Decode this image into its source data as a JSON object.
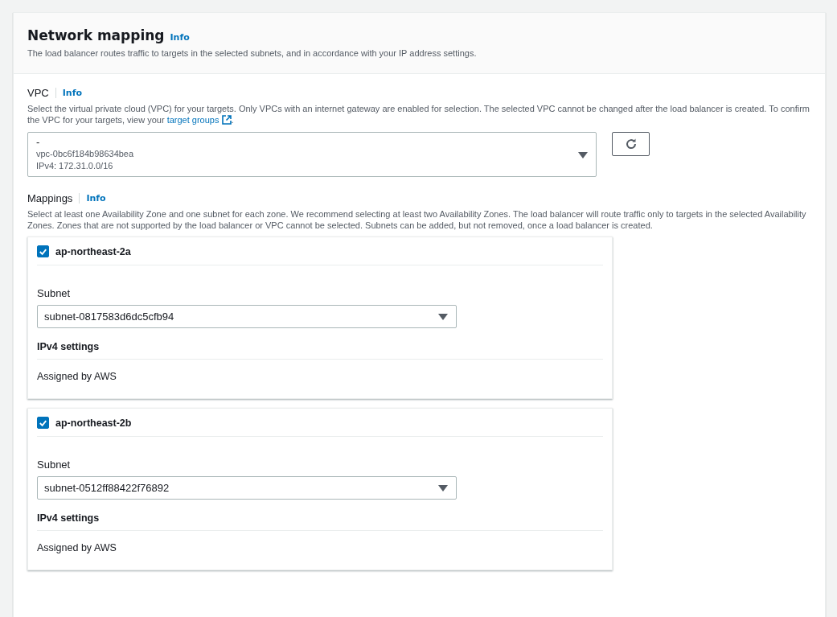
{
  "section": {
    "title": "Network mapping",
    "info_link": "Info",
    "description": "The load balancer routes traffic to targets in the selected subnets, and in accordance with your IP address settings."
  },
  "vpc": {
    "label": "VPC",
    "info_link": "Info",
    "description": "Select the virtual private cloud (VPC) for your targets. Only VPCs with an internet gateway are enabled for selection. The selected VPC cannot be changed after the load balancer is created. To confirm the VPC for your targets, view your",
    "description_link": "target groups",
    "description_end": ".",
    "select": {
      "value": "-",
      "detail_lines": [
        "vpc-0bc6f184b98634bea",
        "IPv4: 172.31.0.0/16"
      ]
    }
  },
  "mappings": {
    "label": "Mappings",
    "info_link": "Info",
    "description": "Select at least one Availability Zone and one subnet for each zone. We recommend selecting at least two Availability Zones. The load balancer will route traffic only to targets in the selected Availability Zones. Zones that are not supported by the load balancer or VPC cannot be selected. Subnets can be added, but not removed, once a load balancer is created.",
    "zones": [
      {
        "name": "ap-northeast-2a",
        "checked": true,
        "subnet_label": "Subnet",
        "subnet": "subnet-0817583d6dc5cfb94",
        "ipv4_label": "IPv4 settings",
        "ipv4_value": "Assigned by AWS"
      },
      {
        "name": "ap-northeast-2b",
        "checked": true,
        "subnet_label": "Subnet",
        "subnet": "subnet-0512ff88422f76892",
        "ipv4_label": "IPv4 settings",
        "ipv4_value": "Assigned by AWS"
      }
    ]
  }
}
